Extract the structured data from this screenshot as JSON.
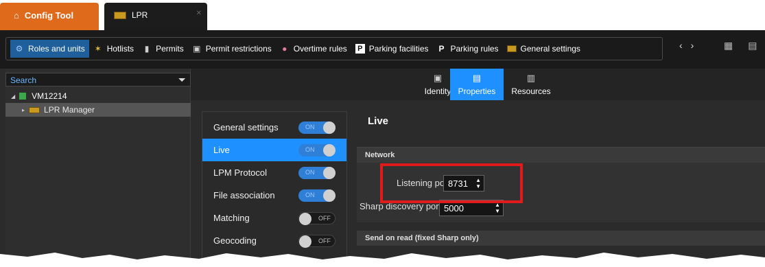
{
  "tabs": {
    "config_tool": "Config Tool",
    "lpr": "LPR"
  },
  "toolbar": {
    "items": [
      {
        "label": "Roles and units",
        "icon": "roles-icon"
      },
      {
        "label": "Hotlists",
        "icon": "hotlist-icon"
      },
      {
        "label": "Permits",
        "icon": "permit-icon"
      },
      {
        "label": "Permit restrictions",
        "icon": "permit-restriction-icon"
      },
      {
        "label": "Overtime rules",
        "icon": "overtime-icon"
      },
      {
        "label": "Parking facilities",
        "icon": "parking-facility-icon"
      },
      {
        "label": "Parking rules",
        "icon": "parking-rule-icon"
      },
      {
        "label": "General settings",
        "icon": "lpr-settings-icon"
      }
    ]
  },
  "tree": {
    "search_placeholder": "Search",
    "nodes": [
      {
        "label": "VM12214"
      },
      {
        "label": "LPR Manager"
      }
    ]
  },
  "page_tabs": [
    {
      "label": "Identity"
    },
    {
      "label": "Properties"
    },
    {
      "label": "Resources"
    }
  ],
  "settings": [
    {
      "label": "General settings",
      "state": "ON"
    },
    {
      "label": "Live",
      "state": "ON"
    },
    {
      "label": "LPM Protocol",
      "state": "ON"
    },
    {
      "label": "File association",
      "state": "ON"
    },
    {
      "label": "Matching",
      "state": "OFF"
    },
    {
      "label": "Geocoding",
      "state": "OFF"
    }
  ],
  "content": {
    "title": "Live",
    "network_header": "Network",
    "listening_port_label": "Listening port:",
    "listening_port_value": "8731",
    "sharp_discovery_label": "Sharp discovery port:",
    "sharp_discovery_value": "5000",
    "send_on_read_header": "Send on read (fixed Sharp only)"
  },
  "colors": {
    "accent": "#1e90ff",
    "config_tab": "#e06a1c",
    "highlight": "#e11b1b"
  }
}
